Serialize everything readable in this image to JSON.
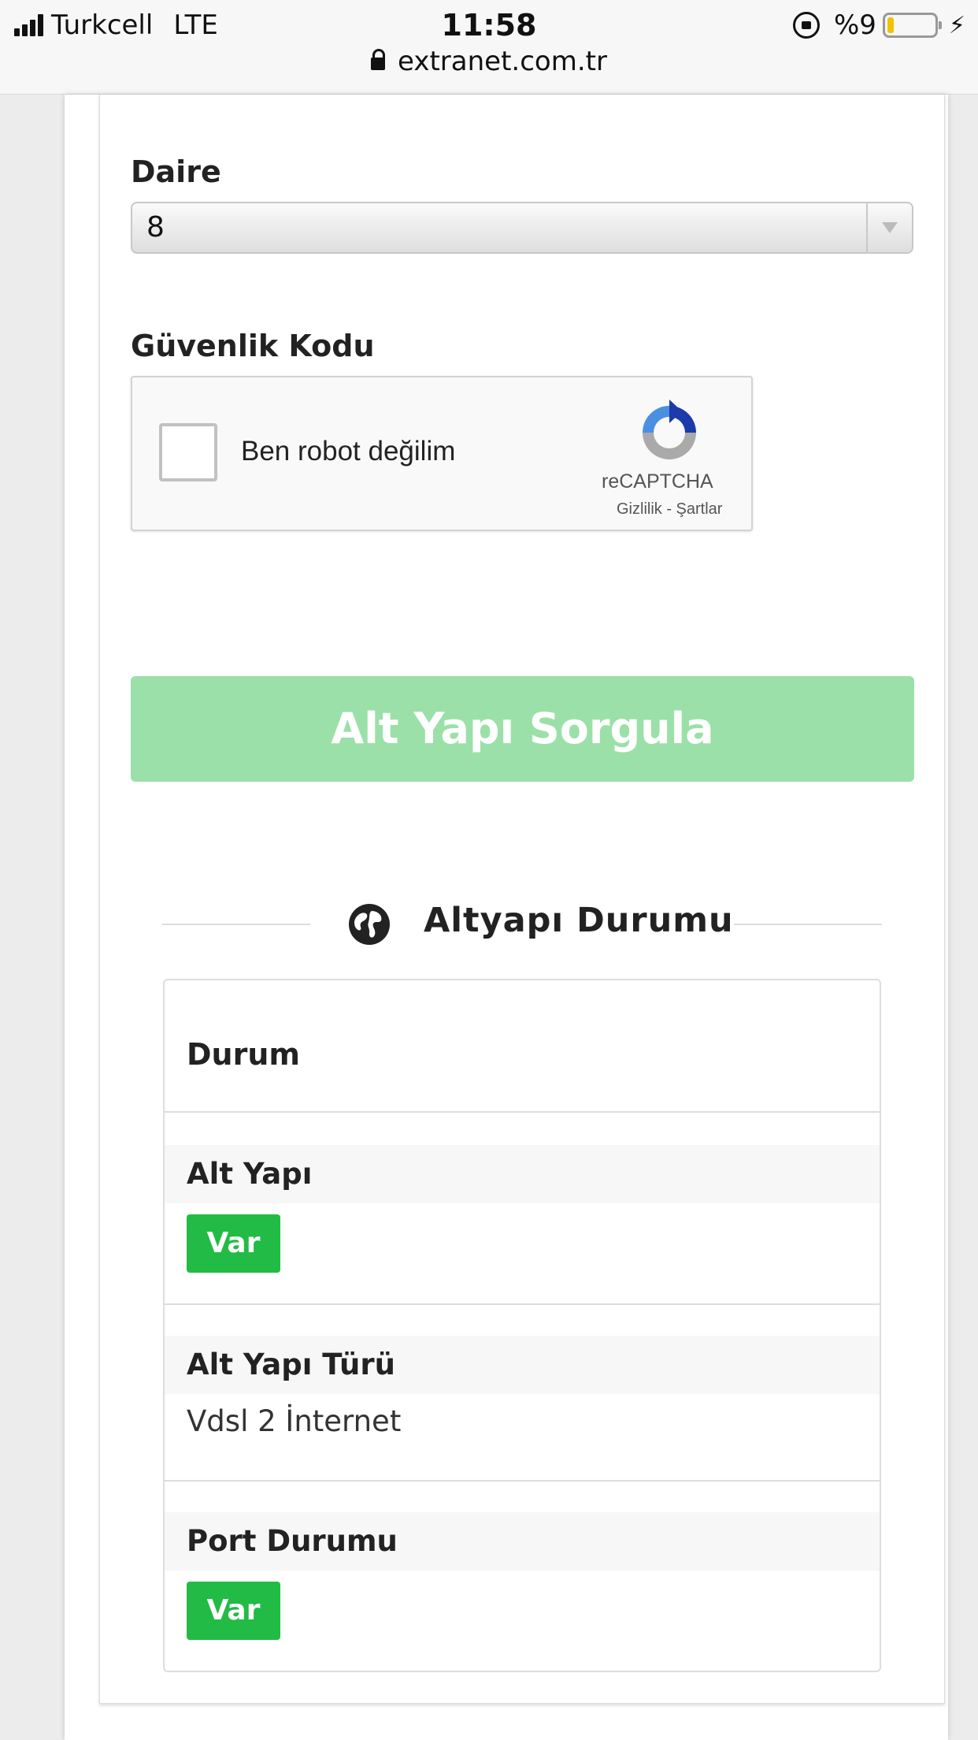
{
  "status_bar": {
    "carrier": "Turkcell",
    "network": "LTE",
    "time": "11:58",
    "battery": "%9",
    "url": "extranet.com.tr"
  },
  "form": {
    "apartment_label": "Daire",
    "apartment_value": "8",
    "security_label": "Güvenlik Kodu",
    "captcha_text": "Ben robot değilim",
    "captcha_brand": "reCAPTCHA",
    "captcha_links": "Gizlilik - Şartlar",
    "query_button": "Alt Yapı Sorgula"
  },
  "result": {
    "section_title": "Altyapı Durumu",
    "header": "Durum",
    "rows": [
      {
        "label": "Alt Yapı",
        "value": "Var",
        "type": "badge"
      },
      {
        "label": "Alt Yapı Türü",
        "value": "Vdsl 2 İnternet",
        "type": "text"
      },
      {
        "label": "Port Durumu",
        "value": "Var",
        "type": "badge"
      }
    ]
  },
  "colors": {
    "query_button_bg": "#9be0a8",
    "badge_bg": "#22bb45"
  }
}
